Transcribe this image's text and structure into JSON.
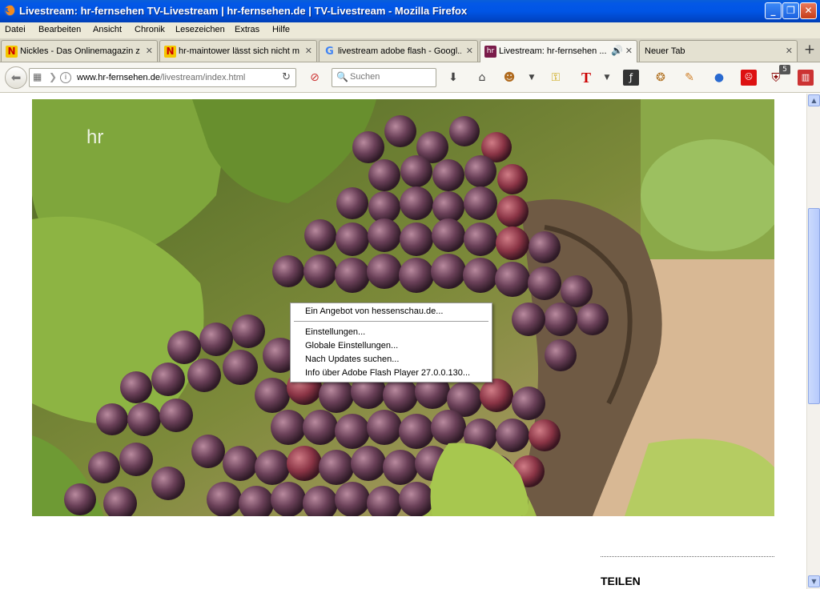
{
  "window": {
    "title": "Livestream: hr-fernsehen TV-Livestream | hr-fernsehen.de | TV-Livestream - Mozilla Firefox",
    "minimize": "_",
    "maximize": "❐",
    "close": "✕"
  },
  "menu": [
    "Datei",
    "Bearbeiten",
    "Ansicht",
    "Chronik",
    "Lesezeichen",
    "Extras",
    "Hilfe"
  ],
  "tabs": [
    {
      "label": "Nickles - Das Onlinemagazin zu...",
      "favicon": "N",
      "icon_color": "#f4c700"
    },
    {
      "label": "hr-maintower lässt sich nicht m...",
      "favicon": "N",
      "icon_color": "#f4c700"
    },
    {
      "label": "livestream adobe flash - Googl...",
      "favicon": "G",
      "icon_color": "#ffffff"
    },
    {
      "label": "Livestream: hr-fernsehen ...",
      "favicon": "hr",
      "icon_color": "#7a1b4a"
    },
    {
      "label": "Neuer Tab",
      "favicon": "",
      "icon_color": "#ffffff"
    }
  ],
  "nav": {
    "url_host": "www.hr-fernsehen.de",
    "url_path": "/livestream/index.html",
    "search_placeholder": "Suchen",
    "badge_count": "5"
  },
  "player": {
    "logo": "hr"
  },
  "context_menu": {
    "offer": "Ein Angebot von hessenschau.de...",
    "items": [
      "Einstellungen...",
      "Globale Einstellungen...",
      "Nach Updates suchen...",
      "Info über Adobe Flash Player 27.0.0.130..."
    ]
  },
  "sidebar": {
    "share_title": "TEILEN"
  }
}
